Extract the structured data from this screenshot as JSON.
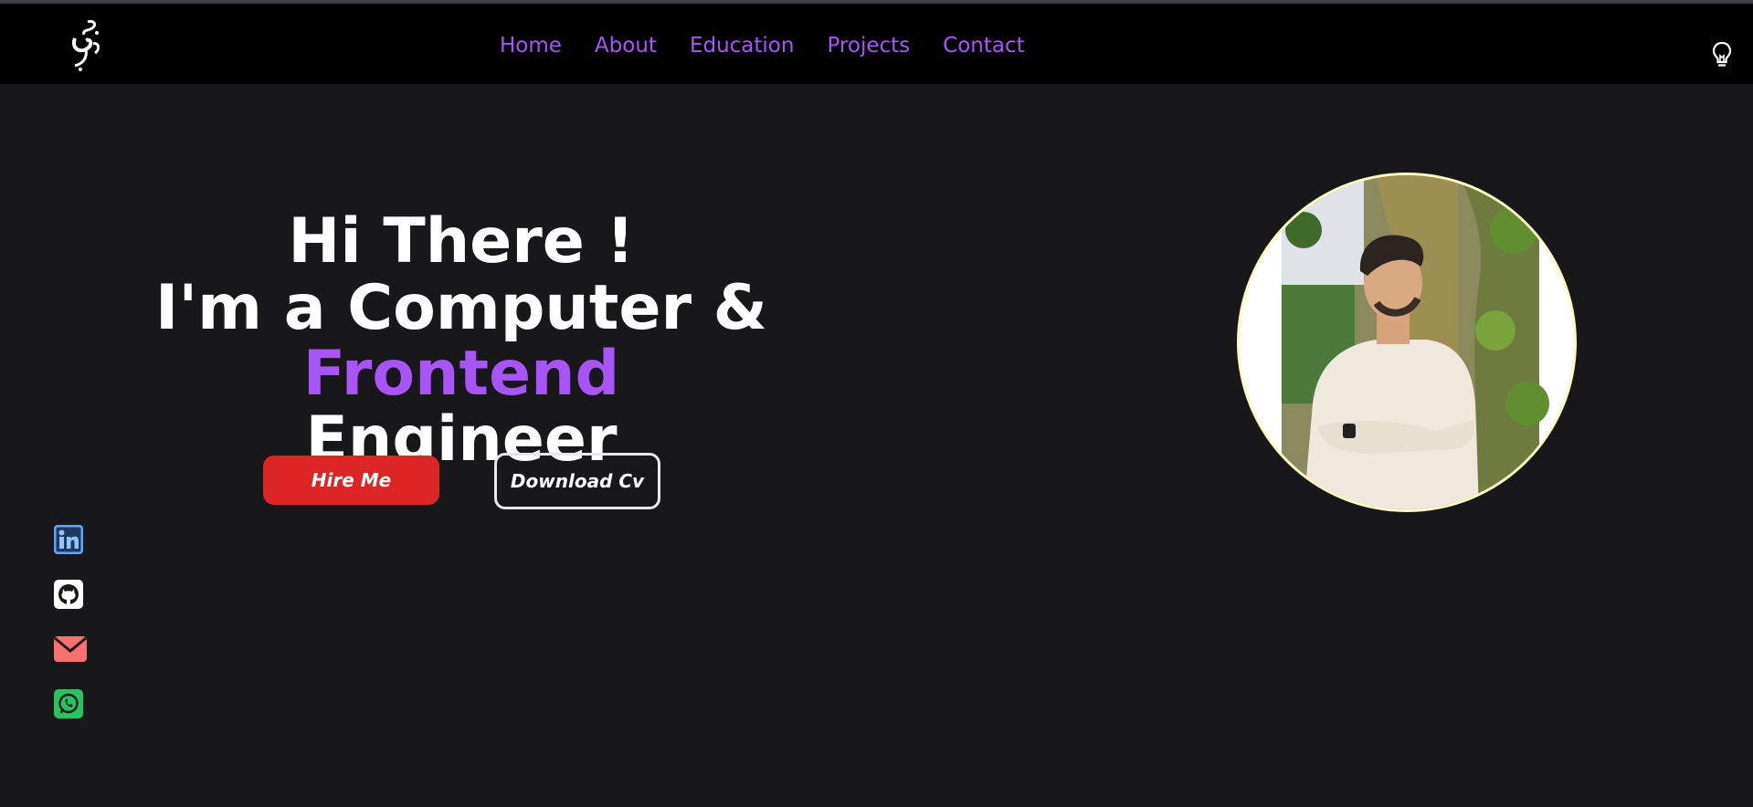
{
  "nav": {
    "logo_icon": "calligraphy-logo-icon",
    "links": [
      "Home",
      "About",
      "Education",
      "Projects",
      "Contact"
    ],
    "theme_toggle_icon": "lightbulb-icon"
  },
  "hero": {
    "line1": "Hi There !",
    "line2": "I'm a Computer &",
    "line3_accent": "Frontend",
    "line3_rest": "Engineer",
    "hire_label": "Hire Me",
    "cv_label": "Download Cv"
  },
  "socials": [
    {
      "name": "linkedin-icon",
      "color": "#60a5fa"
    },
    {
      "name": "github-icon",
      "color": "#ffffff"
    },
    {
      "name": "email-icon",
      "color": "#f87171"
    },
    {
      "name": "whatsapp-icon",
      "color": "#22c55e"
    }
  ],
  "colors": {
    "background": "#18181b",
    "nav_background": "#000000",
    "accent": "#a855f7",
    "hire_button": "#dc2626",
    "avatar_ring": "#fef9c3"
  }
}
